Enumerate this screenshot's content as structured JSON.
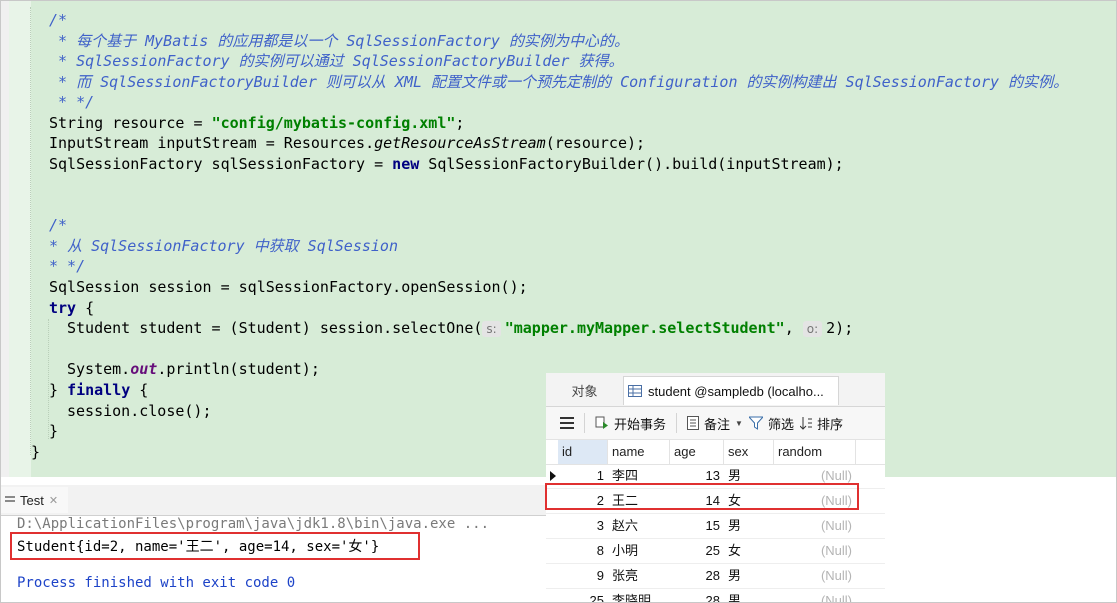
{
  "editor": {
    "comment1": [
      "/*",
      " * 每个基于 MyBatis 的应用都是以一个 SqlSessionFactory 的实例为中心的。",
      " * SqlSessionFactory 的实例可以通过 SqlSessionFactoryBuilder 获得。",
      " * 而 SqlSessionFactoryBuilder 则可以从 XML 配置文件或一个预先定制的 Configuration 的实例构建出 SqlSessionFactory 的实例。",
      " * */"
    ],
    "line_resource": {
      "a": "String resource = ",
      "str": "\"config/mybatis-config.xml\"",
      "b": ";"
    },
    "line_stream": {
      "a": "InputStream inputStream = Resources.",
      "m": "getResourceAsStream",
      "b": "(resource);"
    },
    "line_factory": {
      "a": "SqlSessionFactory sqlSessionFactory = ",
      "kw": "new",
      "b": " SqlSessionFactoryBuilder().build(inputStream);"
    },
    "comment2": [
      "/*",
      "* 从 SqlSessionFactory 中获取 SqlSession",
      "* */"
    ],
    "line_session": "SqlSession session = sqlSessionFactory.openSession();",
    "line_try": {
      "kw": "try",
      "b": " {"
    },
    "line_select": {
      "a": "Student student = (Student) session.selectOne(",
      "hint1": "s:",
      "str": "\"mapper.myMapper.selectStudent\"",
      "c": ", ",
      "hint2": "o:",
      "d": "2);"
    },
    "line_print": {
      "a": "System.",
      "f": "out",
      "b": ".println(student);"
    },
    "line_finally": {
      "a": "} ",
      "kw": "finally",
      "b": " {"
    },
    "line_close": "session.close();",
    "line_end1": "}",
    "line_end2": "}"
  },
  "run": {
    "tab_label": "Test",
    "path": "D:\\ApplicationFiles\\program\\java\\jdk1.8\\bin\\java.exe ...",
    "output": "Student{id=2, name='王二', age=14, sex='女'}",
    "exit": "Process finished with exit code 0"
  },
  "db": {
    "tab_objects": "对象",
    "tab_table": "student @sampledb (localho...",
    "toolbar": {
      "begin_tx": "开始事务",
      "note": "备注",
      "filter": "筛选",
      "sort": "排序"
    },
    "columns": [
      "id",
      "name",
      "age",
      "sex",
      "random"
    ],
    "rows": [
      {
        "id": "1",
        "name": "李四",
        "age": "13",
        "sex": "男",
        "random": "(Null)"
      },
      {
        "id": "2",
        "name": "王二",
        "age": "14",
        "sex": "女",
        "random": "(Null)"
      },
      {
        "id": "3",
        "name": "赵六",
        "age": "15",
        "sex": "男",
        "random": "(Null)"
      },
      {
        "id": "8",
        "name": "小明",
        "age": "25",
        "sex": "女",
        "random": "(Null)"
      },
      {
        "id": "9",
        "name": "张亮",
        "age": "28",
        "sex": "男",
        "random": "(Null)"
      },
      {
        "id": "25",
        "name": "李晓明",
        "age": "28",
        "sex": "男",
        "random": "(Null)"
      }
    ]
  }
}
